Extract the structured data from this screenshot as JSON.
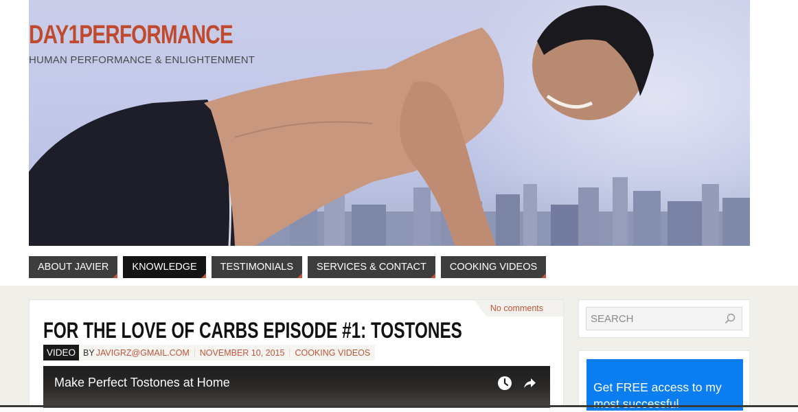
{
  "site": {
    "logo": "DAY1PERFORMANCE",
    "tagline": "HUMAN PERFORMANCE & ENLIGHTENMENT"
  },
  "nav": {
    "items": [
      {
        "label": "ABOUT JAVIER",
        "active": false
      },
      {
        "label": "KNOWLEDGE",
        "active": true
      },
      {
        "label": "TESTIMONIALS",
        "active": false
      },
      {
        "label": "SERVICES & CONTACT",
        "active": false
      },
      {
        "label": "COOKING VIDEOS",
        "active": false
      }
    ]
  },
  "post": {
    "comments": "No comments",
    "title": "FOR THE LOVE OF CARBS EPISODE #1: TOSTONES",
    "format": "VIDEO",
    "by": "BY",
    "author": "JAVIGRZ@GMAIL.COM",
    "date": "NOVEMBER 10, 2015",
    "category": "COOKING VIDEOS",
    "video": {
      "title": "Make Perfect Tostones at Home",
      "icons": [
        "watch-later-icon",
        "share-icon"
      ]
    }
  },
  "sidebar": {
    "search_placeholder": "SEARCH",
    "promo_text": "Get FREE access to my most successful"
  },
  "colors": {
    "accent": "#c0533a",
    "nav_bg": "#3d3d3d",
    "nav_active_bg": "#141414",
    "promo_bg": "#0a7ef0",
    "band_bg": "#f0efea"
  }
}
